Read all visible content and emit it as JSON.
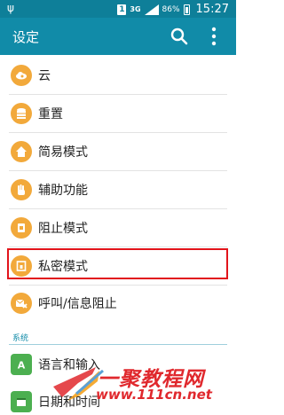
{
  "status_bar": {
    "sim_slot": "1",
    "network": "3G",
    "battery": "86%",
    "time": "15:27"
  },
  "app_bar": {
    "title": "设定"
  },
  "items": [
    {
      "label": "云",
      "icon": "cloud-icon"
    },
    {
      "label": "重置",
      "icon": "database-reset-icon"
    },
    {
      "label": "简易模式",
      "icon": "home-icon"
    },
    {
      "label": "辅助功能",
      "icon": "hand-icon"
    },
    {
      "label": "阻止模式",
      "icon": "block-icon"
    },
    {
      "label": "私密模式",
      "icon": "private-lock-icon"
    },
    {
      "label": "呼叫/信息阻止",
      "icon": "call-block-icon"
    }
  ],
  "section_system": "系统",
  "system_items": [
    {
      "label": "语言和输入",
      "icon": "language-icon"
    },
    {
      "label": "日期和时间",
      "icon": "calendar-icon"
    }
  ],
  "watermark": {
    "text": "一聚教程网",
    "url": "www.111cn.net"
  },
  "colors": {
    "status_bar": "#0e7f99",
    "app_bar": "#118ba8",
    "icon_orange": "#f2a93b",
    "highlight": "#e2141b"
  }
}
